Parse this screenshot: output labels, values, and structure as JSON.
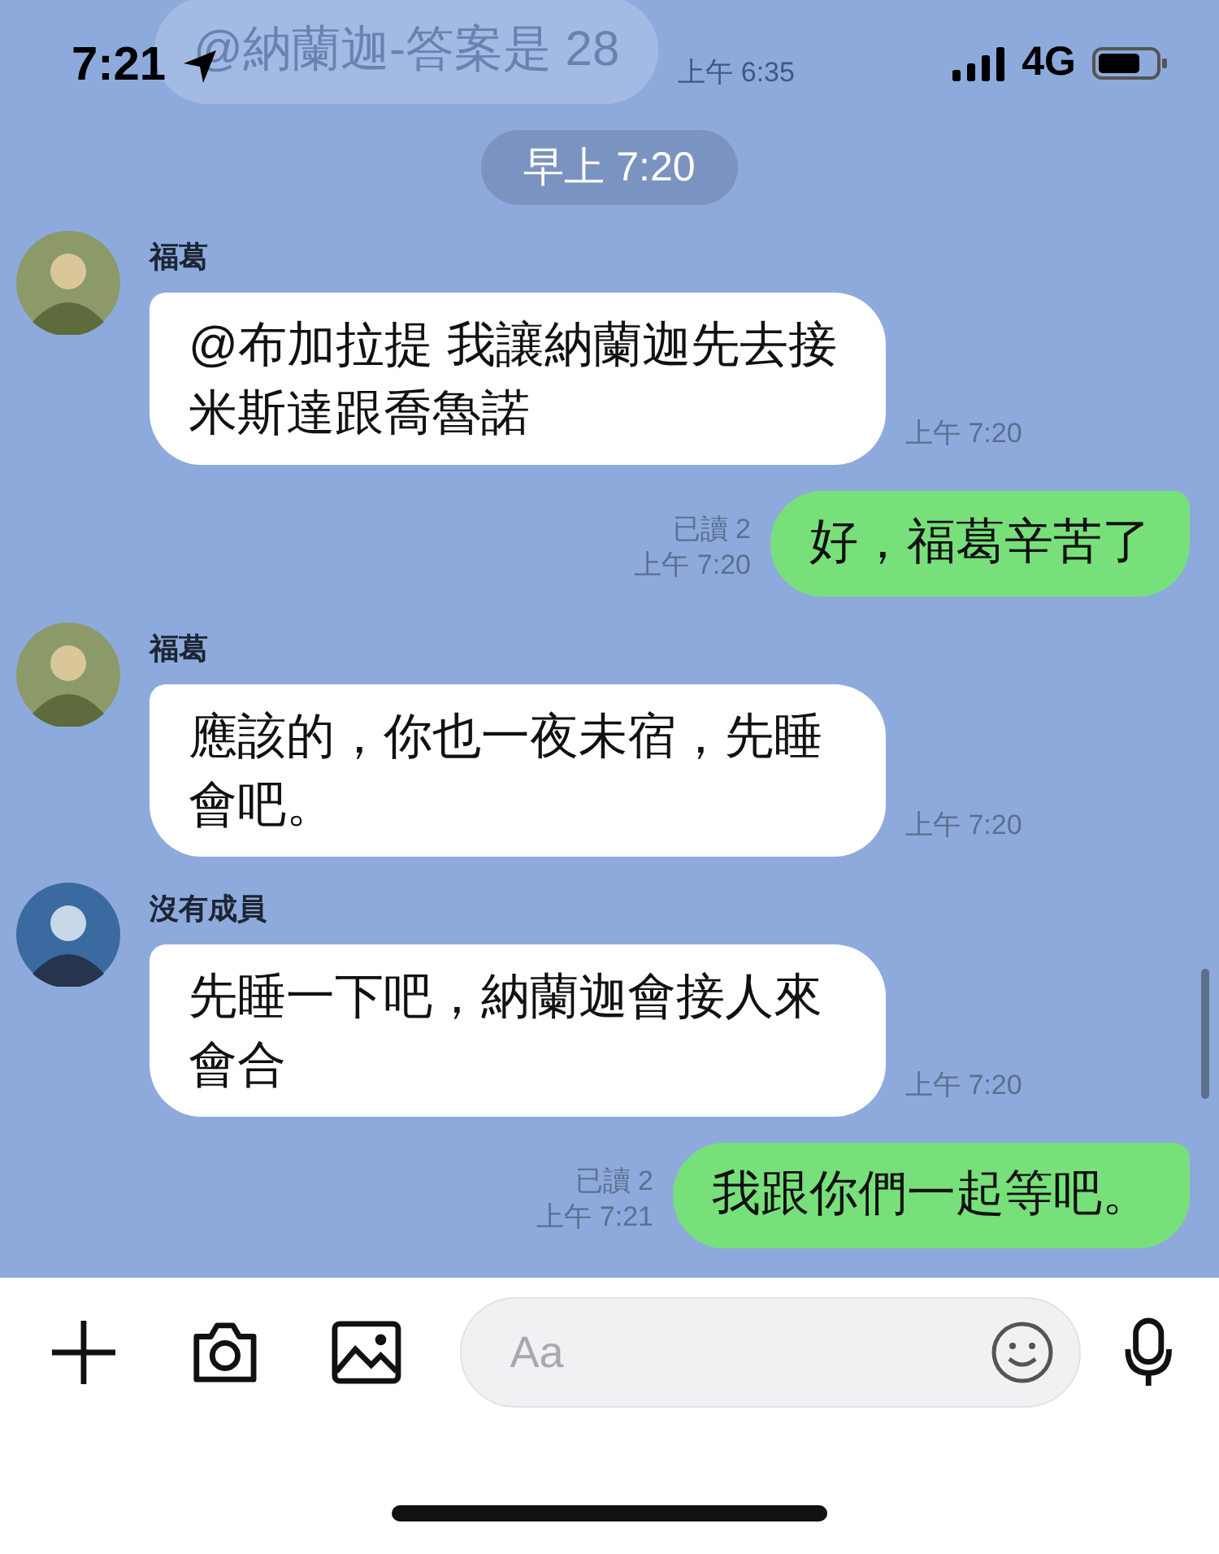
{
  "status_bar": {
    "time": "7:21",
    "network": "4G"
  },
  "faded_message": {
    "text": "@納蘭迦-答案是 28",
    "time": "上午 6:35"
  },
  "messages": [
    {
      "kind": "date",
      "text": "早上 7:20"
    },
    {
      "kind": "incoming",
      "sender": "福葛",
      "text": "@布加拉提 我讓納蘭迦先去接米斯達跟喬魯諾",
      "time": "上午 7:20"
    },
    {
      "kind": "outgoing",
      "read": "已讀 2",
      "time": "上午 7:20",
      "text": "好，福葛辛苦了"
    },
    {
      "kind": "incoming",
      "sender": "福葛",
      "text": "應該的，你也一夜未宿，先睡會吧。",
      "time": "上午 7:20"
    },
    {
      "kind": "incoming",
      "sender": "沒有成員",
      "text": "先睡一下吧，納蘭迦會接人來會合",
      "time": "上午 7:20"
    },
    {
      "kind": "outgoing",
      "read": "已讀 2",
      "time": "上午 7:21",
      "text": "我跟你們一起等吧。"
    }
  ],
  "input_bar": {
    "placeholder": "Aa"
  }
}
